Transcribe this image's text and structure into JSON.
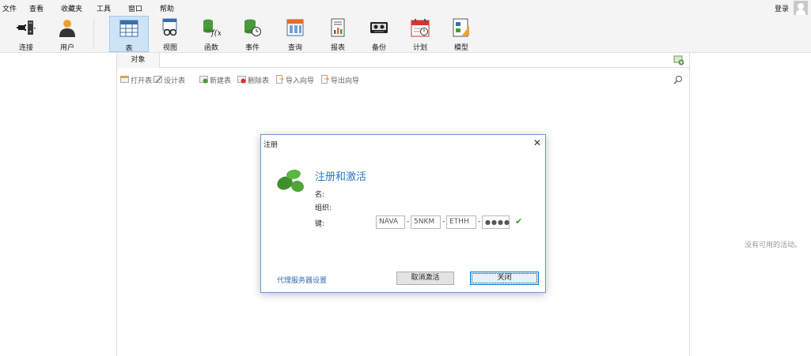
{
  "menu": [
    "文件",
    "查看",
    "收藏夹",
    "工具",
    "窗口",
    "帮助"
  ],
  "login_label": "登录",
  "toolbar": {
    "connect": "连接",
    "user": "用户",
    "table": "表",
    "view": "视图",
    "function": "函数",
    "event": "事件",
    "query": "查询",
    "report": "报表",
    "backup": "备份",
    "schedule": "计划",
    "model": "模型"
  },
  "object_tab": "对象",
  "object_actions": [
    "打开表",
    "设计表",
    "新建表",
    "删除表",
    "导入向导",
    "导出向导"
  ],
  "right_panel": {
    "empty_text": "没有可用的活动。"
  },
  "dialog": {
    "title": "注册",
    "heading": "注册和激活",
    "name_label": "名:",
    "org_label": "组织:",
    "key_label": "键:",
    "key_parts": [
      "NAVA",
      "5NKM",
      "ETHH",
      "●●●●"
    ],
    "proxy_link": "代理服务器设置",
    "deactivate_button": "取消激活",
    "close_button": "关闭"
  },
  "colors": {
    "accent": "#2f78c5",
    "active_tool_bg": "#cde3f6",
    "check_green": "#3a9a2a"
  }
}
